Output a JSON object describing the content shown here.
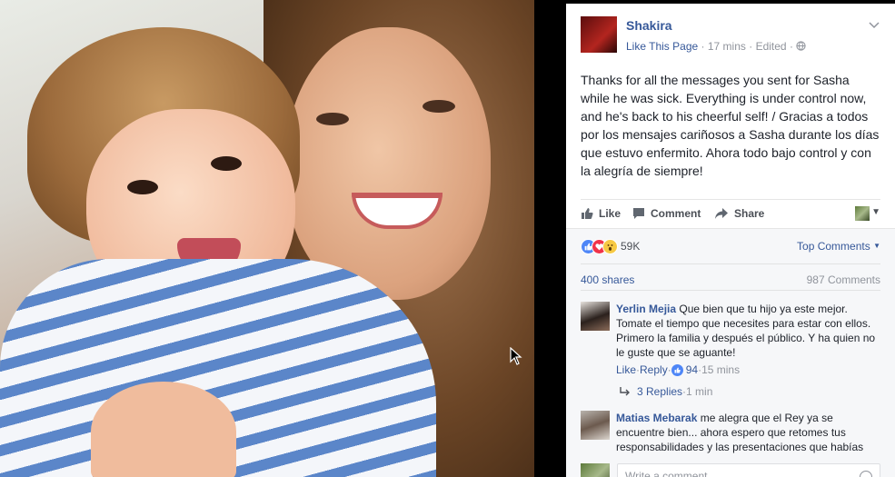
{
  "post": {
    "page_name": "Shakira",
    "like_page": "Like This Page",
    "time": "17 mins",
    "edited": "Edited",
    "text": "Thanks for all the messages you sent for Sasha while he was sick. Everything is under control now, and he's back to his cheerful self! / Gracias a todos por los mensajes cariñosos a Sasha durante los días que estuvo enfermito. Ahora todo bajo control y con la alegría de siempre!"
  },
  "actions": {
    "like": "Like",
    "comment": "Comment",
    "share": "Share"
  },
  "feedback": {
    "reaction_count": "59K",
    "sort_label": "Top Comments",
    "shares": "400 shares",
    "comments_count": "987 Comments"
  },
  "comments": [
    {
      "author": "Yerlin Mejia",
      "text": "Que bien que tu hijo ya este mejor. Tomate el tiempo que necesites para estar con ellos. Primero la familia y después el público. Y ha quien no le guste que se aguante!",
      "like": "Like",
      "reply": "Reply",
      "likes": "94",
      "time": "15 mins",
      "replies": "3 Replies",
      "replies_time": "1 min"
    },
    {
      "author": "Matias Mebarak",
      "text": "me alegra que el Rey ya se encuentre bien... ahora espero que retomes tus responsabilidades y las presentaciones que habías"
    }
  ],
  "composer": {
    "placeholder": "Write a comment..."
  },
  "colors": {
    "link": "#365899",
    "meta": "#90949c",
    "text": "#1d2129",
    "like_blue": "#4e86f7"
  }
}
